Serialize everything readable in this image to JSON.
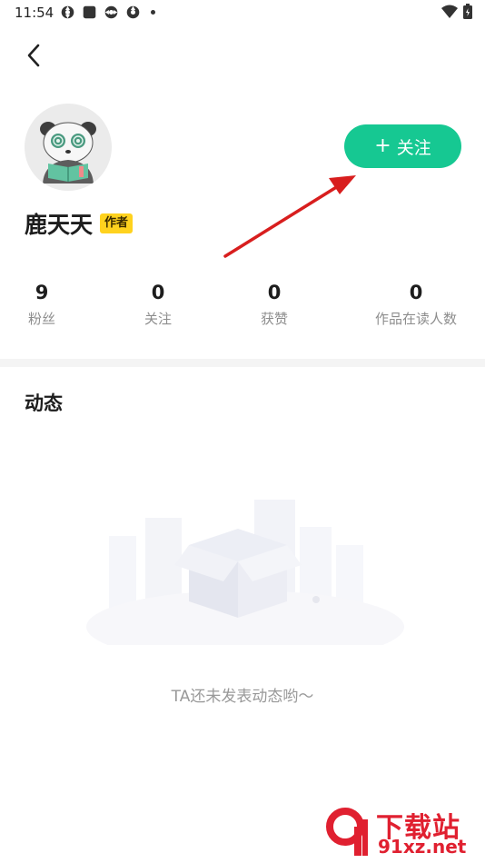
{
  "status_bar": {
    "time": "11:54"
  },
  "profile": {
    "name": "鹿天天",
    "badge": "作者",
    "follow_plus": "+",
    "follow_label": "关注"
  },
  "stats": [
    {
      "value": "9",
      "label": "粉丝"
    },
    {
      "value": "0",
      "label": "关注"
    },
    {
      "value": "0",
      "label": "获赞"
    },
    {
      "value": "0",
      "label": "作品在读人数"
    }
  ],
  "feed": {
    "title": "动态",
    "empty_text": "TA还未发表动态哟～"
  },
  "watermark": {
    "title": "下载站",
    "domain": "91xz.net"
  },
  "colors": {
    "accent": "#16c892",
    "badge": "#ffd21e",
    "arrow": "#e02020"
  },
  "icons": {
    "back": "back-arrow-icon",
    "avatar": "panda-avatar",
    "status_left": [
      "app-icon",
      "app-icon",
      "app-icon",
      "app-icon"
    ],
    "status_right": [
      "wifi-icon",
      "battery-icon"
    ]
  }
}
